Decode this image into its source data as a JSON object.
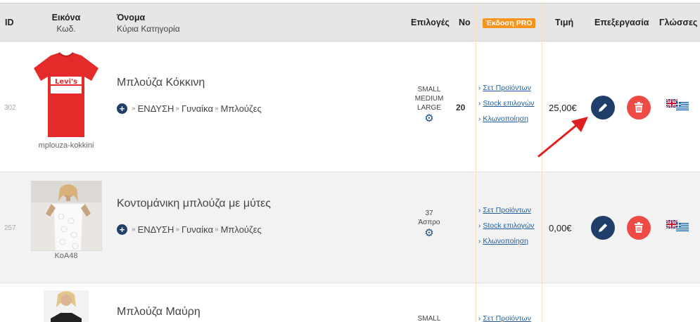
{
  "header": {
    "id": "ID",
    "image": "Εικόνα",
    "image_sub": "Κωδ.",
    "name": "Όνομα",
    "name_sub": "Κύρια Κατηγορία",
    "options": "Επιλογές",
    "qty": "Νο",
    "pro": "Έκδοση PRO",
    "price": "Τιμή",
    "edit": "Επεξεργασία",
    "languages": "Γλώσσες"
  },
  "rows": [
    {
      "id": "302",
      "code": "mplouza-kokkini",
      "name": "Μπλούζα Κόκκινη",
      "category": [
        "ΕΝΔΥΣΗ",
        "Γυναίκα",
        "Μπλούζες"
      ],
      "options": [
        "SMALL",
        "MEDIUM",
        "LARGE"
      ],
      "qty": "20",
      "links": [
        "Σετ Προϊόντων",
        "Stock επιλογών",
        "Κλωνοποίηση"
      ],
      "price": "25,00€"
    },
    {
      "id": "257",
      "code": "ΚοΑ48",
      "name": "Κοντομάνικη μπλούζα με μύτες",
      "category": [
        "ΕΝΔΥΣΗ",
        "Γυναίκα",
        "Μπλούζες"
      ],
      "options": [
        "37",
        "Άσπρο"
      ],
      "qty": "",
      "links": [
        "Σετ Προϊόντων",
        "Stock επιλογών",
        "Κλωνοποίηση"
      ],
      "price": "0,00€"
    },
    {
      "name": "Μπλούζα Μαύρη",
      "options": [
        "SMALL"
      ],
      "links": [
        "Σετ Προϊόντων"
      ]
    }
  ],
  "icons": {
    "add": "plus-circle-icon",
    "options": "gear-icon",
    "edit": "pencil-icon",
    "delete": "trash-icon",
    "lang_en": "uk-flag-icon",
    "lang_gr": "greece-flag-icon"
  },
  "colors": {
    "header_bg": "#e6e6e6",
    "edit_button": "#1f3f6a",
    "delete_button": "#ee4b45",
    "pro_badge": "#f7941d",
    "link": "#1f5f9f",
    "annotation_arrow": "#e02020"
  }
}
